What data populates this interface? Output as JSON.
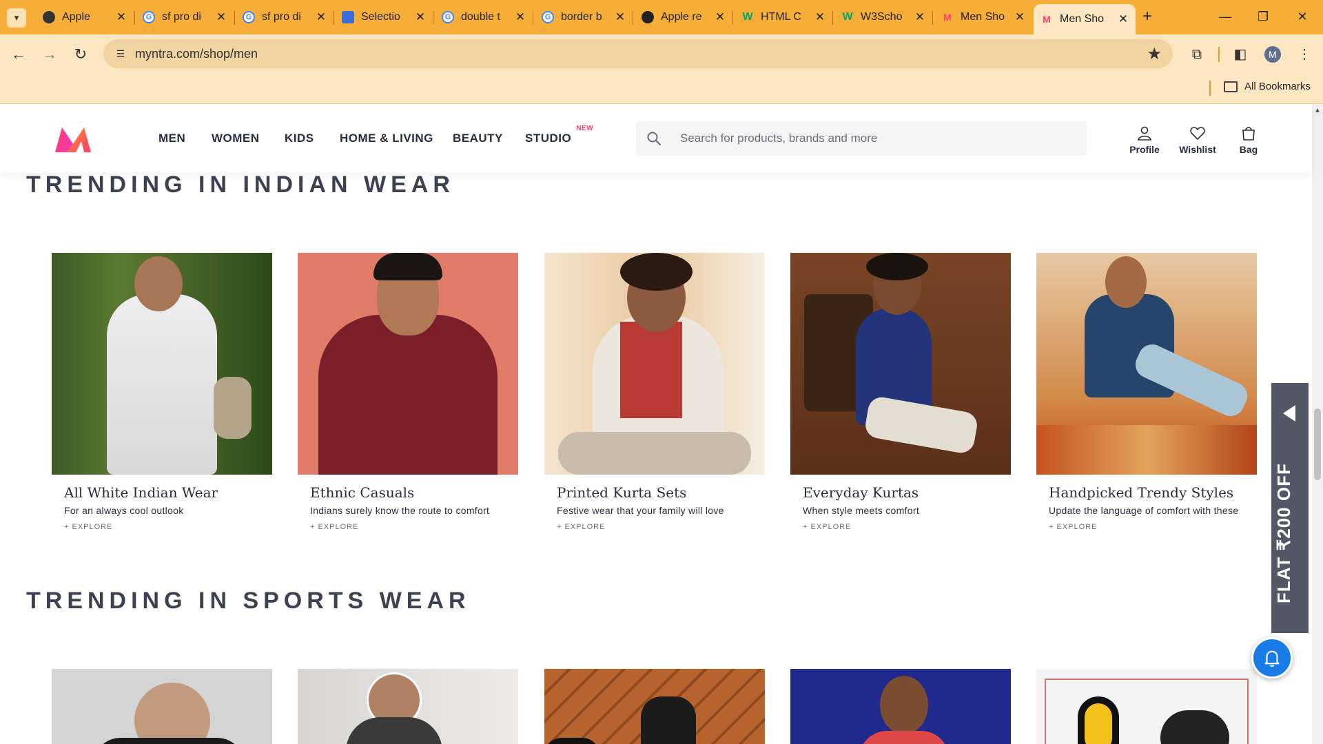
{
  "browser": {
    "tabs": [
      {
        "label": "Apple",
        "icon": "apple-favicon"
      },
      {
        "label": "sf pro di",
        "icon": "google-favicon"
      },
      {
        "label": "sf pro di",
        "icon": "google-favicon"
      },
      {
        "label": "Selectio",
        "icon": "puzzle-favicon"
      },
      {
        "label": "double t",
        "icon": "google-favicon"
      },
      {
        "label": "border b",
        "icon": "google-favicon"
      },
      {
        "label": "Apple re",
        "icon": "apple-favicon"
      },
      {
        "label": "HTML C",
        "icon": "w3schools-favicon"
      },
      {
        "label": "W3Scho",
        "icon": "w3schools-favicon"
      },
      {
        "label": "Men Sho",
        "icon": "myntra-favicon"
      },
      {
        "label": "Men Sho",
        "icon": "myntra-favicon",
        "active": true
      }
    ],
    "url": "myntra.com/shop/men",
    "bookmarks_label": "All Bookmarks",
    "profile_initial": "M"
  },
  "site": {
    "nav": [
      "MEN",
      "WOMEN",
      "KIDS",
      "HOME & LIVING",
      "BEAUTY",
      "STUDIO"
    ],
    "studio_badge": "NEW",
    "search_placeholder": "Search for products, brands and more",
    "actions": {
      "profile": "Profile",
      "wishlist": "Wishlist",
      "bag": "Bag"
    },
    "brand_colors": {
      "pink": "#ff3f6c",
      "orange": "#f13ab1",
      "accent": "#ff3f6c"
    }
  },
  "sections": {
    "indian": {
      "title": "TRENDING IN INDIAN WEAR",
      "cards": [
        {
          "title": "All White Indian Wear",
          "subtitle": "For an always cool outlook",
          "explore": "+ EXPLORE"
        },
        {
          "title": "Ethnic Casuals",
          "subtitle": "Indians surely know the route to comfort",
          "explore": "+ EXPLORE"
        },
        {
          "title": "Printed Kurta Sets",
          "subtitle": "Festive wear that your family will love",
          "explore": "+ EXPLORE"
        },
        {
          "title": "Everyday Kurtas",
          "subtitle": "When style meets comfort",
          "explore": "+ EXPLORE"
        },
        {
          "title": "Handpicked Trendy Styles",
          "subtitle": "Update the language of comfort with these",
          "explore": "+ EXPLORE"
        }
      ]
    },
    "sports": {
      "title": "TRENDING IN SPORTS WEAR"
    }
  },
  "promo": {
    "text": "FLAT ₹200 OFF"
  }
}
